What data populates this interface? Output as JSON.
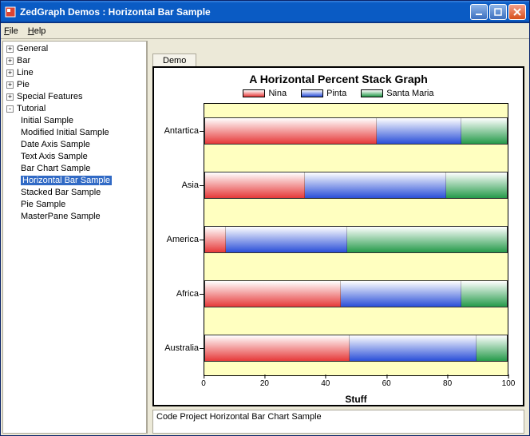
{
  "window": {
    "title": "ZedGraph Demos : Horizontal Bar Sample"
  },
  "menu": {
    "file": "File",
    "help": "Help"
  },
  "tree": {
    "general": "General",
    "bar": "Bar",
    "line": "Line",
    "pie": "Pie",
    "special": "Special Features",
    "tutorial": "Tutorial",
    "items": {
      "initial": "Initial Sample",
      "modified": "Modified Initial Sample",
      "date": "Date Axis Sample",
      "text": "Text Axis Sample",
      "barchart": "Bar Chart Sample",
      "hbar": "Horizontal Bar Sample",
      "stacked": "Stacked Bar Sample",
      "piesample": "Pie Sample",
      "master": "MasterPane Sample"
    }
  },
  "tab": {
    "demo": "Demo"
  },
  "chart": {
    "title": "A Horizontal Percent Stack Graph",
    "xlabel": "Stuff",
    "legend": {
      "s1": "Nina",
      "s2": "Pinta",
      "s3": "Santa Maria"
    },
    "xticks": {
      "t0": "0",
      "t20": "20",
      "t40": "40",
      "t60": "60",
      "t80": "80",
      "t100": "100"
    },
    "cats": {
      "c1": "Antartica",
      "c2": "Asia",
      "c3": "America",
      "c4": "Africa",
      "c5": "Australia"
    }
  },
  "status": {
    "text": "Code Project Horizontal Bar Chart Sample"
  },
  "chart_data": {
    "type": "bar",
    "orientation": "horizontal",
    "stacked": "percent",
    "title": "A Horizontal Percent Stack Graph",
    "xlabel": "Stuff",
    "ylabel": "",
    "xlim": [
      0,
      100
    ],
    "categories": [
      "Antartica",
      "Asia",
      "America",
      "Africa",
      "Australia"
    ],
    "series": [
      {
        "name": "Nina",
        "values": [
          57,
          33,
          7,
          45,
          48
        ]
      },
      {
        "name": "Pinta",
        "values": [
          28,
          47,
          40,
          40,
          42
        ]
      },
      {
        "name": "Santa Maria",
        "values": [
          15,
          20,
          53,
          15,
          10
        ]
      }
    ],
    "legend_position": "top",
    "grid": false
  }
}
